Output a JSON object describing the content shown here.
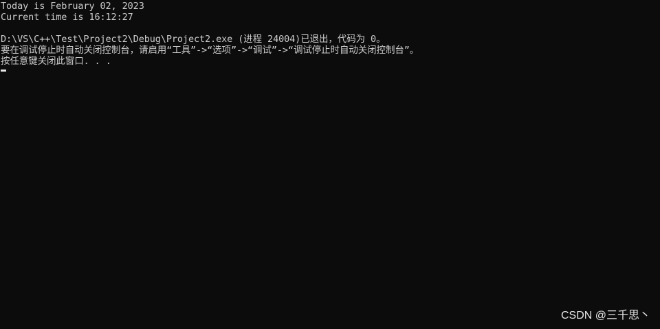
{
  "console": {
    "lines": [
      "Today is February 02, 2023",
      "Current time is 16:12:27",
      "",
      "D:\\VS\\C++\\Test\\Project2\\Debug\\Project2.exe (进程 24004)已退出，代码为 0。",
      "要在调试停止时自动关闭控制台，请启用“工具”->“选项”->“调试”->“调试停止时自动关闭控制台”。",
      "按任意键关闭此窗口. . ."
    ],
    "cursor": "_"
  },
  "watermark": {
    "text": "CSDN @三千思丶"
  },
  "colors": {
    "background": "#0c0c0c",
    "text": "#cccccc",
    "cursor": "#e8e8e8",
    "watermark": "#e6e6e6"
  }
}
